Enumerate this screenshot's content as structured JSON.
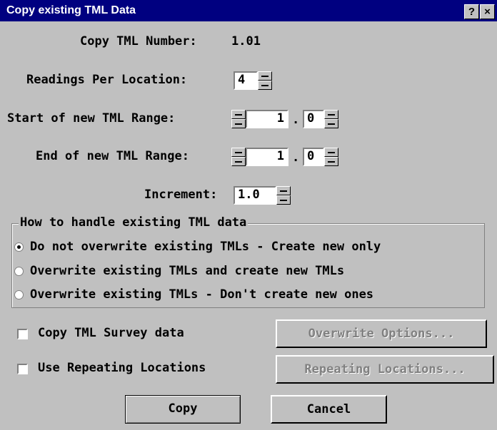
{
  "window": {
    "title": "Copy existing TML Data",
    "help_label": "?",
    "close_label": "×"
  },
  "copy_tml_number": {
    "label": "Copy TML Number:",
    "value": "1.01"
  },
  "readings_per_location": {
    "label": "Readings Per Location:",
    "value": "4"
  },
  "start_range": {
    "label": "Start of new TML Range:",
    "major": "1",
    "separator": ".",
    "minor": "0"
  },
  "end_range": {
    "label": "End of new TML Range:",
    "major": "1",
    "separator": ".",
    "minor": "0"
  },
  "increment": {
    "label": "Increment:",
    "value": "1.0"
  },
  "existing_data_group": {
    "legend": "How to handle existing TML data",
    "options": [
      "Do not overwrite existing TMLs - Create new only",
      "Overwrite existing TMLs and create new TMLs",
      "Overwrite existing TMLs - Don't create new ones"
    ],
    "selected_index": 0
  },
  "copy_survey": {
    "label": "Copy TML Survey data",
    "checked": false
  },
  "use_repeating": {
    "label": "Use Repeating Locations",
    "checked": false
  },
  "buttons": {
    "overwrite_options": "Overwrite Options...",
    "repeating_locations": "Repeating Locations...",
    "copy": "Copy",
    "cancel": "Cancel"
  }
}
